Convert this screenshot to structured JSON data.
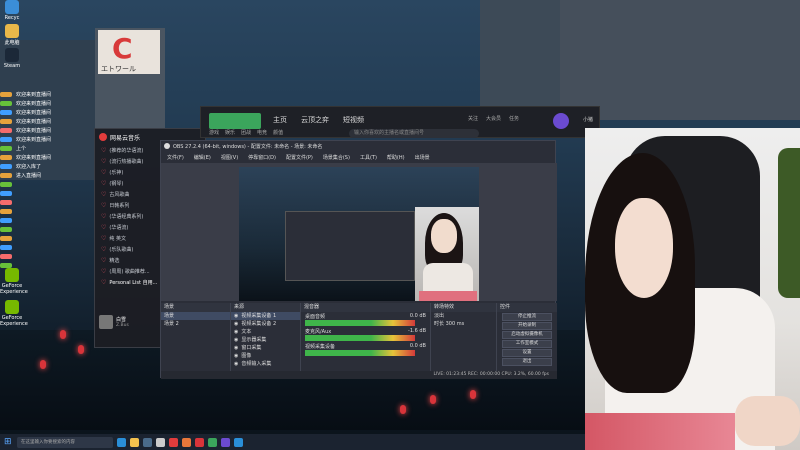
{
  "desktop": {
    "icons": [
      {
        "label": "Recyc",
        "color": "#3b8ed8"
      },
      {
        "label": "Steam",
        "color": "#1b2838"
      },
      {
        "label": "此电脑",
        "color": "#e8b84a"
      },
      {
        "label": "GeForce Experience",
        "color": "#76b900"
      },
      {
        "label": "GeForce Experience",
        "color": "#76b900"
      }
    ],
    "sign_char": "C",
    "sign_text": "エトワール"
  },
  "chat": {
    "lines": [
      {
        "name": "",
        "text": "欢迎来到直播间",
        "badge": "#e6a23c"
      },
      {
        "name": "",
        "text": "欢迎来到直播间",
        "badge": "#67c23a"
      },
      {
        "name": "",
        "text": "欢迎来到直播间",
        "badge": "#409eff"
      },
      {
        "name": "",
        "text": "欢迎来到直播间",
        "badge": "#e6a23c"
      },
      {
        "name": "",
        "text": "欢迎来到直播间",
        "badge": "#f56c6c"
      },
      {
        "name": "",
        "text": "欢迎来到直播间",
        "badge": "#409eff"
      },
      {
        "name": "",
        "text": "上个",
        "badge": "#67c23a"
      },
      {
        "name": "",
        "text": "欢迎来到直播间",
        "badge": "#e6a23c"
      },
      {
        "name": "",
        "text": "欢迎入库了",
        "badge": "#409eff"
      },
      {
        "name": "",
        "text": "进入直播间",
        "badge": "#e6a23c"
      },
      {
        "name": "",
        "text": "",
        "badge": "#67c23a"
      },
      {
        "name": "",
        "text": "",
        "badge": "#409eff"
      },
      {
        "name": "",
        "text": "",
        "badge": "#f56c6c"
      },
      {
        "name": "",
        "text": "",
        "badge": "#e6a23c"
      },
      {
        "name": "",
        "text": "",
        "badge": "#409eff"
      },
      {
        "name": "",
        "text": "",
        "badge": "#67c23a"
      },
      {
        "name": "",
        "text": "",
        "badge": "#e6a23c"
      },
      {
        "name": "",
        "text": "",
        "badge": "#409eff"
      },
      {
        "name": "",
        "text": "",
        "badge": "#f56c6c"
      },
      {
        "name": "",
        "text": "",
        "badge": "#67c23a"
      }
    ]
  },
  "music": {
    "title": "网易云音乐",
    "items": [
      {
        "label": "(推荐的华语流)",
        "active": false
      },
      {
        "label": "(流行热播歌曲)",
        "active": false
      },
      {
        "label": "(乐神)",
        "active": false
      },
      {
        "label": "(钢琴)",
        "active": false
      },
      {
        "label": "古风歌曲",
        "active": false
      },
      {
        "label": "日韩系列",
        "active": false
      },
      {
        "label": "(华语经典系列)",
        "active": false
      },
      {
        "label": "(华语流)",
        "active": false
      },
      {
        "label": "纯 英文",
        "active": false
      },
      {
        "label": "(乐队歌曲)",
        "active": false
      },
      {
        "label": "精选",
        "active": false
      },
      {
        "label": "(周周) 歌曲推荐...",
        "active": false
      },
      {
        "label": "Personal List 自用...",
        "active": true
      }
    ],
    "now_playing_title": "白雪",
    "now_playing_artist": "Z.Bus"
  },
  "client": {
    "nav": [
      "主页",
      "云顶之弈",
      "短视频"
    ],
    "categories": [
      "游戏",
      "娱乐",
      "团战",
      "电竞",
      "颜值"
    ],
    "search_placeholder": "输入你喜欢的主播名或直播间号",
    "stats": [
      "关注",
      "大会员",
      "任务"
    ],
    "username": "小猪"
  },
  "obs": {
    "title": "OBS 27.2.4 (64-bit, windows) - 配置文件: 未命名 - 场景: 未命名",
    "menu": [
      "文件(F)",
      "编辑(E)",
      "视图(V)",
      "停靠窗口(D)",
      "配置文件(P)",
      "场景集合(S)",
      "工具(T)",
      "帮助(H)",
      "出场景"
    ],
    "scenes_header": "场景",
    "scenes": [
      "场景",
      "场景 2"
    ],
    "sources_header": "来源",
    "sources": [
      "视频采集设备 1",
      "视频采集设备 2",
      "文本",
      "显示器采集",
      "窗口采集",
      "图像",
      "音频输入采集"
    ],
    "mixer_header": "混音器",
    "mixer": [
      {
        "label": "桌面音频",
        "value": "0.0 dB"
      },
      {
        "label": "麦克风/Aux",
        "value": "-1.6 dB"
      },
      {
        "label": "视频采集设备",
        "value": "0.0 dB"
      }
    ],
    "transitions_header": "转场特效",
    "transition_mode": "淡出",
    "transition_duration": "时长 300 ms",
    "controls_header": "控件",
    "controls": [
      "停止推流",
      "开始录制",
      "启动虚拟摄像机",
      "工作室模式",
      "设置",
      "退出"
    ],
    "status": "LIVE: 01:23:45  REC: 00:00:00  CPU: 3.2%, 60.00 fps"
  },
  "taskbar": {
    "search_placeholder": "在这里输入你要搜索的内容",
    "apps": [
      {
        "name": "edge-icon",
        "color": "#2a8fd8"
      },
      {
        "name": "folder-icon",
        "color": "#f2c14e"
      },
      {
        "name": "steam-icon",
        "color": "#4a6b8a"
      },
      {
        "name": "obs-icon",
        "color": "#cccccc"
      },
      {
        "name": "music-icon",
        "color": "#e23c3c"
      },
      {
        "name": "app-icon",
        "color": "#e8773a"
      },
      {
        "name": "app-icon",
        "color": "#d8343a"
      },
      {
        "name": "app-icon",
        "color": "#3ba55c"
      },
      {
        "name": "app-icon",
        "color": "#6b4bd0"
      },
      {
        "name": "app-icon",
        "color": "#2a8fd8"
      }
    ]
  }
}
